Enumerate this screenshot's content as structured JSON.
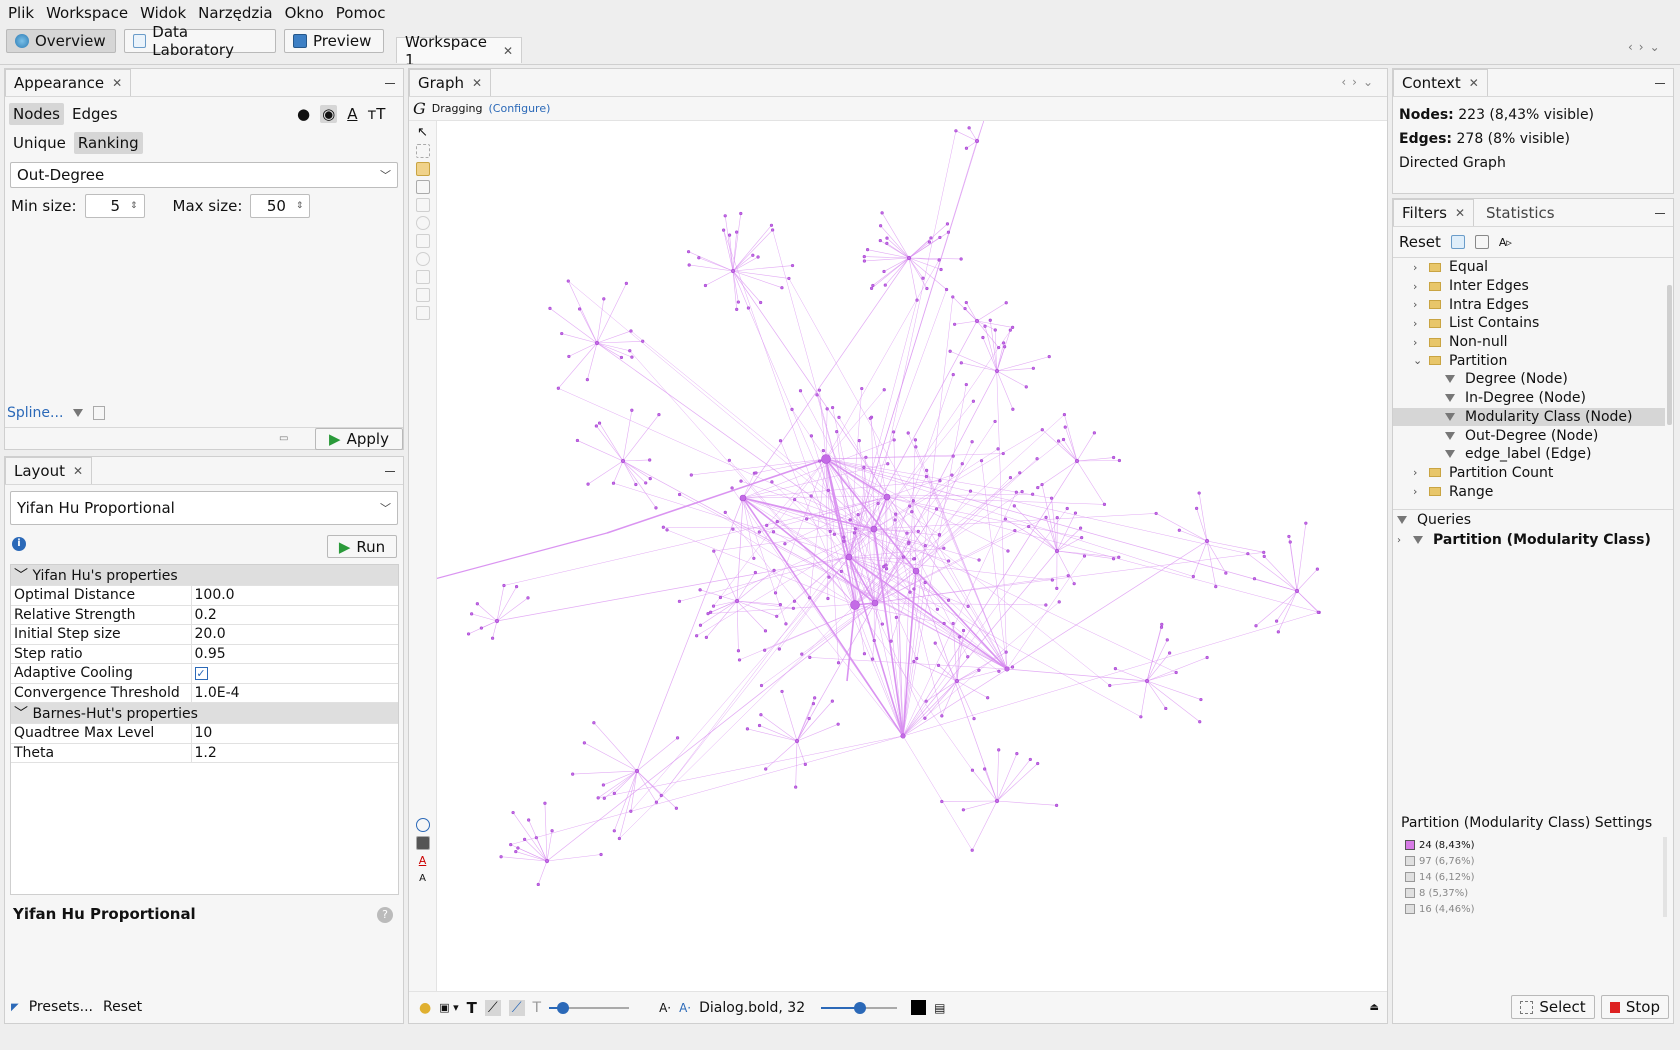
{
  "menu": [
    "Plik",
    "Workspace",
    "Widok",
    "Narzędzia",
    "Okno",
    "Pomoc"
  ],
  "top_buttons": {
    "overview": "Overview",
    "data_lab": "Data Laboratory",
    "preview": "Preview"
  },
  "workspace_tab": "Workspace 1",
  "appearance": {
    "title": "Appearance",
    "tabs": [
      "Nodes",
      "Edges"
    ],
    "modes": [
      "Unique",
      "Ranking"
    ],
    "attribute": "Out-Degree",
    "min_label": "Min size:",
    "min_value": "5",
    "max_label": "Max size:",
    "max_value": "50",
    "spline": "Spline...",
    "apply": "Apply"
  },
  "layout": {
    "title": "Layout",
    "algorithm": "Yifan Hu Proportional",
    "run": "Run",
    "groups": [
      {
        "name": "Yifan Hu's properties",
        "rows": [
          {
            "k": "Optimal Distance",
            "v": "100.0"
          },
          {
            "k": "Relative Strength",
            "v": "0.2"
          },
          {
            "k": "Initial Step size",
            "v": "20.0"
          },
          {
            "k": "Step ratio",
            "v": "0.95"
          },
          {
            "k": "Adaptive Cooling",
            "v": "✓"
          },
          {
            "k": "Convergence Threshold",
            "v": "1.0E-4"
          }
        ]
      },
      {
        "name": "Barnes-Hut's properties",
        "rows": [
          {
            "k": "Quadtree Max Level",
            "v": "10"
          },
          {
            "k": "Theta",
            "v": "1.2"
          }
        ]
      }
    ],
    "description_title": "Yifan Hu Proportional",
    "presets": "Presets...",
    "reset": "Reset"
  },
  "graph": {
    "title": "Graph",
    "mode": "Dragging",
    "configure": "(Configure)",
    "font_label": "Dialog.bold, 32",
    "colors": {
      "edge": "#d88ef0",
      "node": "#c46be6",
      "node_stroke": "#a94ad2"
    }
  },
  "context": {
    "title": "Context",
    "nodes_label": "Nodes:",
    "nodes_value": "223 (8,43% visible)",
    "edges_label": "Edges:",
    "edges_value": "278 (8% visible)",
    "graph_type": "Directed Graph"
  },
  "filters": {
    "tabs": [
      "Filters",
      "Statistics"
    ],
    "reset": "Reset",
    "tree": [
      {
        "label": "Equal",
        "kind": "folder",
        "level": 0,
        "expanded": false
      },
      {
        "label": "Inter Edges",
        "kind": "folder",
        "level": 0,
        "expanded": false
      },
      {
        "label": "Intra Edges",
        "kind": "folder",
        "level": 0,
        "expanded": false
      },
      {
        "label": "List Contains",
        "kind": "folder",
        "level": 0,
        "expanded": false
      },
      {
        "label": "Non-null",
        "kind": "folder",
        "level": 0,
        "expanded": false
      },
      {
        "label": "Partition",
        "kind": "folder",
        "level": 0,
        "expanded": true
      },
      {
        "label": "Degree (Node)",
        "kind": "filter",
        "level": 1
      },
      {
        "label": "In-Degree (Node)",
        "kind": "filter",
        "level": 1
      },
      {
        "label": "Modularity Class (Node)",
        "kind": "filter",
        "level": 1,
        "selected": true
      },
      {
        "label": "Out-Degree (Node)",
        "kind": "filter",
        "level": 1
      },
      {
        "label": "edge_label (Edge)",
        "kind": "filter",
        "level": 1
      },
      {
        "label": "Partition Count",
        "kind": "folder",
        "level": 0,
        "expanded": false
      },
      {
        "label": "Range",
        "kind": "folder",
        "level": 0,
        "expanded": false
      }
    ],
    "queries_label": "Queries",
    "query": "Partition (Modularity Class)",
    "settings_title": "Partition (Modularity Class) Settings",
    "partitions": [
      {
        "label": "24 (8,43%)",
        "active": true,
        "color": "#d77be6"
      },
      {
        "label": "97 (6,76%)",
        "active": false
      },
      {
        "label": "14 (6,12%)",
        "active": false
      },
      {
        "label": "8 (5,37%)",
        "active": false
      },
      {
        "label": "16 (4,46%)",
        "active": false
      }
    ],
    "select": "Select",
    "stop": "Stop"
  }
}
